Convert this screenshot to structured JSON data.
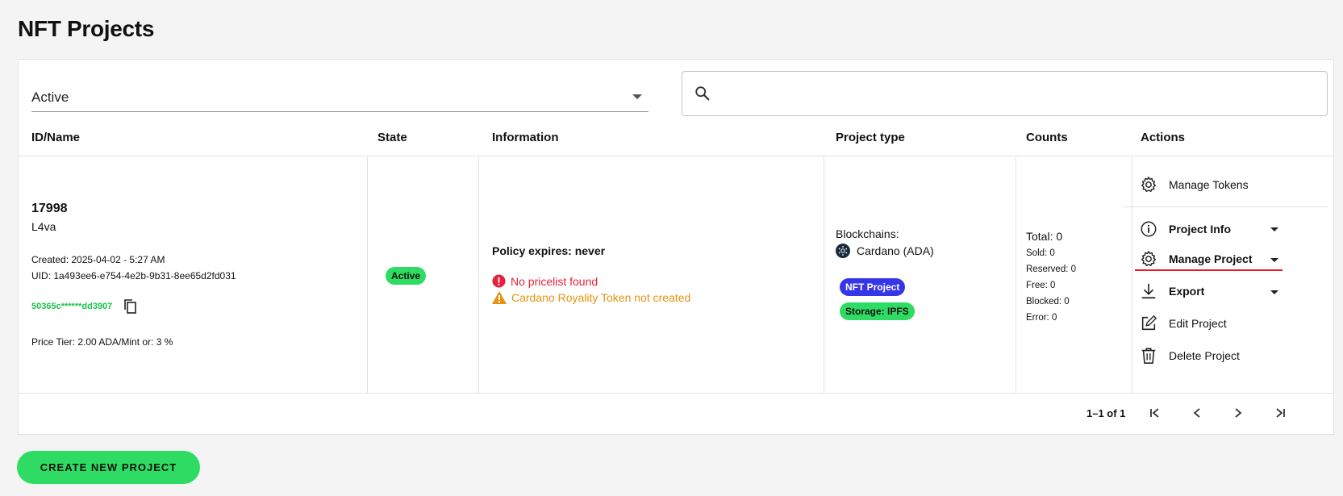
{
  "page": {
    "title": "NFT Projects"
  },
  "filter": {
    "selected": "Active"
  },
  "search": {
    "value": "",
    "placeholder": ""
  },
  "table": {
    "headers": [
      "ID/Name",
      "State",
      "Information",
      "Project type",
      "Counts",
      "Actions"
    ],
    "rows": [
      {
        "id": "17998",
        "name": "L4va",
        "created": "Created: 2025-04-02 - 5:27 AM",
        "uid": "UID: 1a493ee6-e754-4e2b-9b31-8ee65d2fd031",
        "address": "50365c******dd3907",
        "price_tier": "Price Tier: 2.00 ADA/Mint or: 3 %",
        "state": "Active",
        "policy": "Policy expires: never",
        "warnings": {
          "pricelist": "No pricelist found",
          "royalty": "Cardano Royality Token not created"
        },
        "blockchains_label": "Blockchains:",
        "blockchain": "Cardano (ADA)",
        "project_type_badge": "NFT Project",
        "storage_badge": "Storage: IPFS",
        "counts": {
          "total": "Total: 0",
          "sold": "Sold: 0",
          "reserved": "Reserved: 0",
          "free": "Free: 0",
          "blocked": "Blocked: 0",
          "error": "Error: 0"
        }
      }
    ]
  },
  "actions": {
    "manage_tokens": "Manage Tokens",
    "project_info": "Project Info",
    "manage_project": "Manage Project",
    "export": "Export",
    "edit_project": "Edit Project",
    "delete_project": "Delete Project"
  },
  "pagination": {
    "range": "1–1 of 1"
  },
  "create_button": "CREATE NEW PROJECT",
  "colors": {
    "accent_green": "#2fdc63",
    "nft_badge": "#3636e8",
    "error_red": "#e5223c",
    "warning_orange": "#e6930f",
    "highlight_underline": "#e51b2c"
  }
}
